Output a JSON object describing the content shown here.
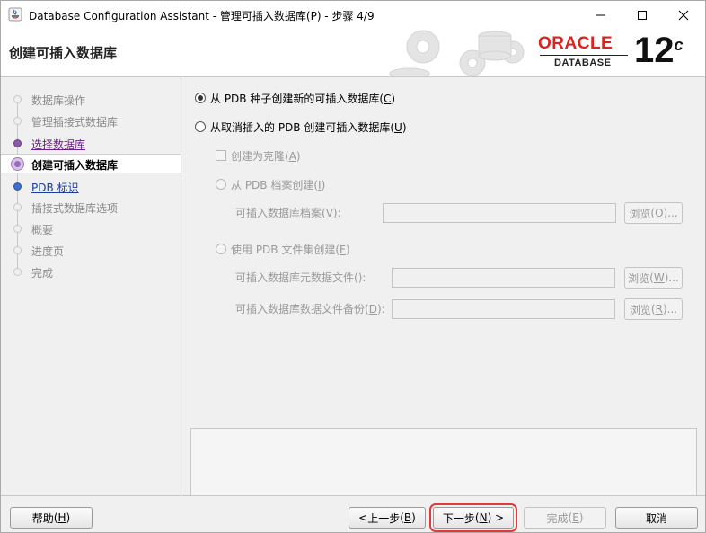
{
  "window": {
    "title": "Database Configuration Assistant - 管理可插入数据库(P) - 步骤 4/9"
  },
  "banner": {
    "heading": "创建可插入数据库",
    "brand": "ORACLE",
    "brand_sub": "DATABASE",
    "version": "12",
    "version_suffix": "c",
    "brand_color": "#d8261f"
  },
  "nav": {
    "items": [
      {
        "label": "数据库操作",
        "state": "done"
      },
      {
        "label": "管理插接式数据库",
        "state": "done"
      },
      {
        "label": "选择数据库",
        "state": "link"
      },
      {
        "label": "创建可插入数据库",
        "state": "current"
      },
      {
        "label": "PDB 标识",
        "state": "next"
      },
      {
        "label": "插接式数据库选项",
        "state": "pending"
      },
      {
        "label": "概要",
        "state": "pending"
      },
      {
        "label": "进度页",
        "state": "pending"
      },
      {
        "label": "完成",
        "state": "pending"
      }
    ]
  },
  "main": {
    "option_seed": {
      "label": "从 PDB 种子创建新的可插入数据库",
      "mnemonic": "C",
      "checked": true
    },
    "option_unplugged": {
      "label": "从取消插入的 PDB 创建可插入数据库",
      "mnemonic": "U",
      "checked": false
    },
    "clone_checkbox": {
      "label": "创建为克隆",
      "mnemonic": "A",
      "checked": false
    },
    "option_archive": {
      "label": "从 PDB 档案创建",
      "mnemonic": "I"
    },
    "archive_field": {
      "label": "可插入数据库档案",
      "mnemonic": "V",
      "value": ""
    },
    "archive_browse": {
      "label": "浏览",
      "mnemonic": "O"
    },
    "option_fileset": {
      "label": "使用 PDB 文件集创建",
      "mnemonic": "F"
    },
    "metadata_field": {
      "label": "可插入数据库元数据文件",
      "mnemonic": "",
      "value": ""
    },
    "metadata_browse": {
      "label": "浏览",
      "mnemonic": "W"
    },
    "backup_field": {
      "label": "可插入数据库数据文件备份",
      "mnemonic": "D",
      "value": ""
    },
    "backup_browse": {
      "label": "浏览",
      "mnemonic": "R"
    }
  },
  "footer": {
    "help": {
      "label": "帮助",
      "mnemonic": "H"
    },
    "back": {
      "label": "上一步",
      "mnemonic": "B"
    },
    "next": {
      "label": "下一步",
      "mnemonic": "N"
    },
    "finish": {
      "label": "完成",
      "mnemonic": "E"
    },
    "cancel": {
      "label": "取消"
    }
  }
}
